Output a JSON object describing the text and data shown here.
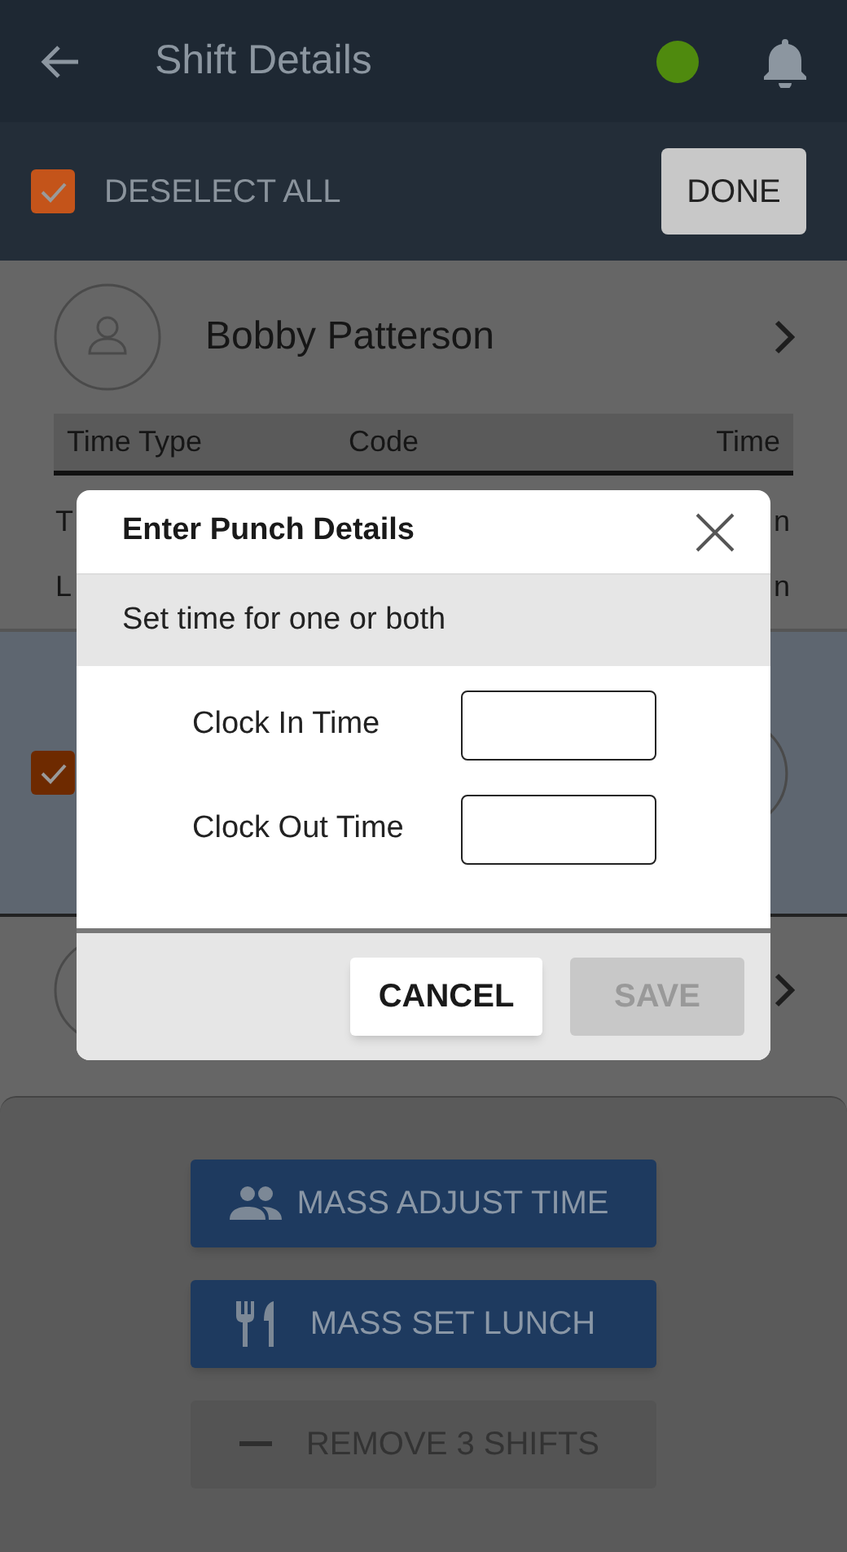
{
  "header": {
    "title": "Shift Details"
  },
  "toolbar": {
    "select_all": {
      "label": "DESELECT ALL",
      "checked": true
    },
    "done": "DONE"
  },
  "shifts": [
    {
      "selected": false,
      "name": "Bobby Patterson",
      "columns": [
        "Time Type",
        "Code",
        "Time"
      ],
      "rows": [
        {
          "time_type": "T",
          "time": "n"
        },
        {
          "time_type": "L",
          "time": "n"
        }
      ]
    },
    {
      "selected": true
    },
    {
      "selected": false
    }
  ],
  "dialog": {
    "title": "Enter Punch Details",
    "subtitle": "Set time for one or both",
    "fields": [
      {
        "label": "Clock In Time"
      },
      {
        "label": "Clock Out Time"
      }
    ],
    "buttons": [
      {
        "label": "CANCEL",
        "disabled": false
      },
      {
        "label": "SAVE",
        "disabled": true
      }
    ]
  },
  "actions": [
    {
      "kind": "people",
      "label": "MASS ADJUST TIME",
      "disabled": false
    },
    {
      "kind": "cutlery",
      "label": "MASS SET LUNCH",
      "disabled": false
    },
    {
      "kind": "minus",
      "label": "REMOVE 3 SHIFTS",
      "disabled": true
    }
  ]
}
